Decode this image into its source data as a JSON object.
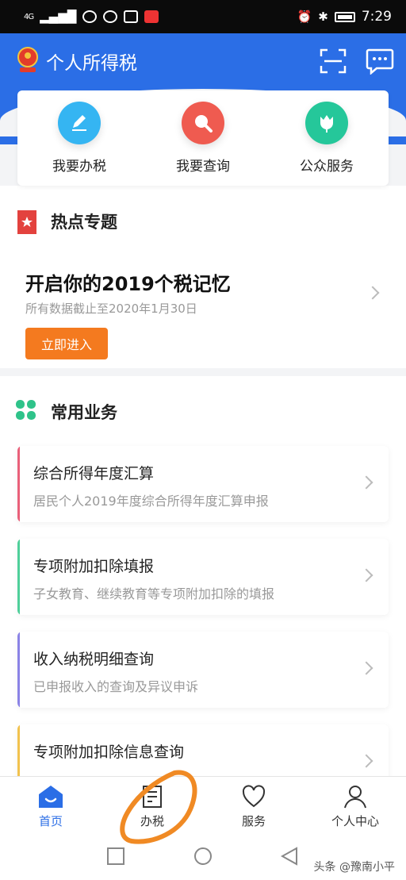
{
  "status": {
    "signal": "4G",
    "time": "7:29"
  },
  "header": {
    "title": "个人所得税"
  },
  "quick": [
    {
      "label": "我要办税",
      "color": "#35b5f2",
      "icon": "pencil-icon"
    },
    {
      "label": "我要查询",
      "color": "#ef5b50",
      "icon": "magnifier-icon"
    },
    {
      "label": "公众服务",
      "color": "#25c79a",
      "icon": "tulip-icon"
    }
  ],
  "hot": {
    "section": "热点专题",
    "title": "开启你的2019个税记忆",
    "subtitle": "所有数据截止至2020年1月30日",
    "button": "立即进入"
  },
  "common": {
    "section": "常用业务",
    "items": [
      {
        "title": "综合所得年度汇算",
        "subtitle": "居民个人2019年度综合所得年度汇算申报",
        "color": "#e9607a"
      },
      {
        "title": "专项附加扣除填报",
        "subtitle": "子女教育、继续教育等专项附加扣除的填报",
        "color": "#4fcf9a"
      },
      {
        "title": "收入纳税明细查询",
        "subtitle": "已申报收入的查询及异议申诉",
        "color": "#8b83e6"
      },
      {
        "title": "专项附加扣除信息查询",
        "subtitle": "",
        "color": "#f2c24e"
      }
    ]
  },
  "tabs": [
    {
      "label": "首页"
    },
    {
      "label": "办税"
    },
    {
      "label": "服务"
    },
    {
      "label": "个人中心"
    }
  ],
  "watermark": "头条 @豫南小平",
  "colors": {
    "primary": "#2b6ee6",
    "accent": "#f47a1f"
  }
}
